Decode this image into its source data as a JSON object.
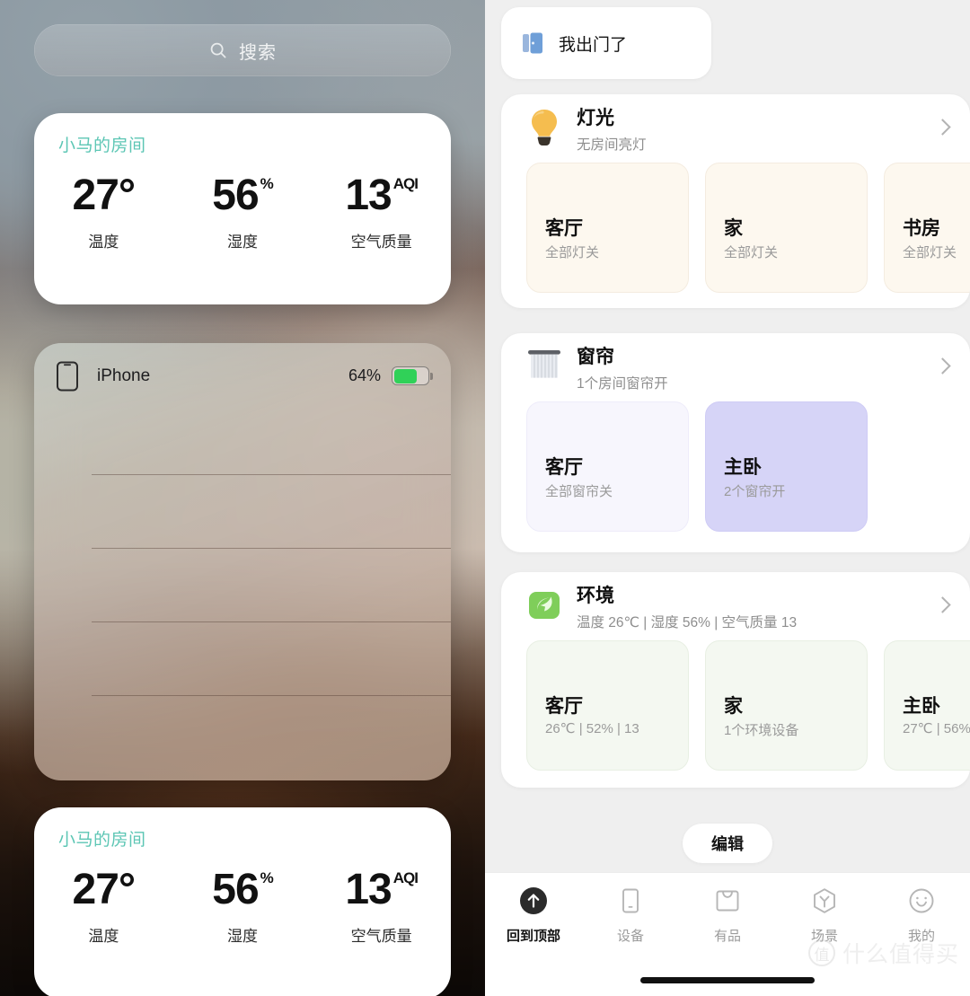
{
  "left": {
    "search": {
      "placeholder": "搜索",
      "icon": "search-icon"
    },
    "widget_top": {
      "title": "小马的房间",
      "stats": [
        {
          "value": "27",
          "unit": "°",
          "label": "温度"
        },
        {
          "value": "56",
          "unit": "%",
          "label": "湿度"
        },
        {
          "value": "13",
          "unit": "AQI",
          "label": "空气质量"
        }
      ]
    },
    "widget_bottom": {
      "title": "小马的房间",
      "stats": [
        {
          "value": "27",
          "unit": "°",
          "label": "温度"
        },
        {
          "value": "56",
          "unit": "%",
          "label": "湿度"
        },
        {
          "value": "13",
          "unit": "AQI",
          "label": "空气质量"
        }
      ]
    },
    "device": {
      "name": "iPhone",
      "battery_percent": "64%",
      "battery_level": 64,
      "icon": "iphone-icon",
      "battery_color": "#30d158"
    }
  },
  "right": {
    "scene_shortcut": {
      "label": "我出门了",
      "icon": "door-icon"
    },
    "groups": [
      {
        "id": "lights",
        "title": "灯光",
        "subtitle": "无房间亮灯",
        "icon": "light-bulb-icon",
        "tile_class": "light",
        "tiles": [
          {
            "name": "客厅",
            "status": "全部灯关",
            "active": false
          },
          {
            "name": "家",
            "status": "全部灯关",
            "active": false
          },
          {
            "name": "书房",
            "status": "全部灯关",
            "active": false
          }
        ]
      },
      {
        "id": "curtain",
        "title": "窗帘",
        "subtitle": "1个房间窗帘开",
        "icon": "curtain-icon",
        "tile_class": "curt",
        "tiles": [
          {
            "name": "客厅",
            "status": "全部窗帘关",
            "active": false
          },
          {
            "name": "主卧",
            "status": "2个窗帘开",
            "active": true
          }
        ]
      },
      {
        "id": "environment",
        "title": "环境",
        "subtitle": "温度 26℃ | 湿度 56% | 空气质量 13",
        "icon": "leaf-icon",
        "tile_class": "env",
        "tiles": [
          {
            "name": "客厅",
            "status": "26℃ | 52% | 13",
            "active": false
          },
          {
            "name": "家",
            "status": "1个环境设备",
            "active": false
          },
          {
            "name": "主卧",
            "status": "27℃ | 56%",
            "active": false
          }
        ]
      }
    ],
    "edit_button": "编辑",
    "tabs": [
      {
        "label": "回到顶部",
        "icon": "arrow-up-circle-icon",
        "active": true
      },
      {
        "label": "设备",
        "icon": "device-icon",
        "active": false
      },
      {
        "label": "有品",
        "icon": "shopping-bag-icon",
        "active": false
      },
      {
        "label": "场景",
        "icon": "scene-hexagon-icon",
        "active": false
      },
      {
        "label": "我的",
        "icon": "smiley-face-icon",
        "active": false
      }
    ],
    "watermark": {
      "badge": "值",
      "text": "什么值得买"
    }
  },
  "colors": {
    "widget_title": "#5cc6b4",
    "light_tile": "#fdf8ef",
    "curtain_tile": "#f7f6fd",
    "curtain_tile_active": "#d6d4f7",
    "env_tile": "#f4f8f1",
    "battery_green": "#30d158"
  }
}
